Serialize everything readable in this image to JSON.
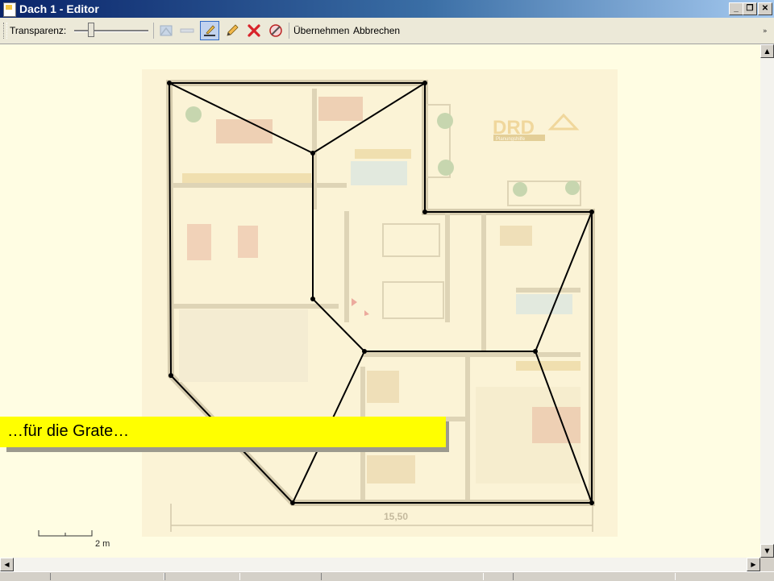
{
  "window": {
    "title": "Dach 1 - Editor",
    "minimize_glyph": "_",
    "restore_glyph": "❐",
    "close_glyph": "✕"
  },
  "toolbar": {
    "transparency_label": "Transparenz:",
    "transparency_level": 0.25,
    "tools": [
      {
        "name": "ridge-tool",
        "icon": "roof-faded-icon",
        "enabled": false
      },
      {
        "name": "hatch-tool",
        "icon": "hatch-faded-icon",
        "enabled": false
      },
      {
        "name": "edit-line-tool",
        "icon": "pen-line-icon",
        "active": true
      },
      {
        "name": "pencil-tool",
        "icon": "pencil-icon"
      },
      {
        "name": "delete-tool",
        "icon": "red-x-icon"
      },
      {
        "name": "roof-edit-tool",
        "icon": "roof-edit-icon"
      }
    ],
    "apply_label": "Übernehmen",
    "cancel_label": "Abbrechen"
  },
  "canvas": {
    "background": "#fffde3",
    "dimension_label": "15,50",
    "scale_label": "2 m",
    "logo_text": "DRD",
    "logo_subtext": "Planungshilfe"
  },
  "callout": {
    "text": "…für die Grate…",
    "color": "#ffff00"
  },
  "scrollbars": {
    "up": "▲",
    "down": "▼",
    "left": "◀",
    "right": "▶"
  }
}
